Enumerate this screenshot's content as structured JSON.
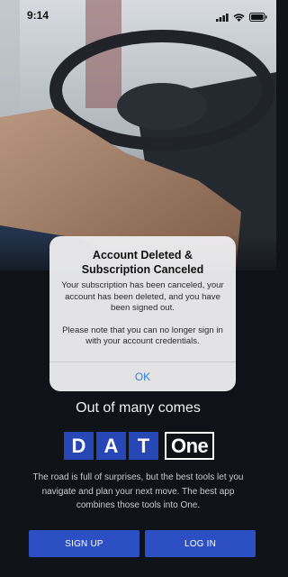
{
  "status_bar": {
    "time": "9:14",
    "icons": [
      "cellular-signal-icon",
      "wifi-icon",
      "battery-icon"
    ]
  },
  "alert": {
    "title": "Account Deleted & Subscription Canceled",
    "message_1": "Your subscription has been canceled, your account has been deleted, and you have been signed out.",
    "message_2": "Please note that you can no longer sign in with your account credentials.",
    "ok_label": "OK"
  },
  "hero": {
    "tagline": "Out of many comes",
    "logo_letters": [
      "D",
      "A",
      "T"
    ],
    "logo_word": "One",
    "description": "The road is full of surprises, but the best tools let you navigate and plan your next move. The best app combines those tools into One."
  },
  "actions": {
    "signup_label": "SIGN UP",
    "login_label": "LOG IN"
  },
  "colors": {
    "brand_blue": "#2d4fc4",
    "alert_action": "#2f7fe0",
    "background": "#101318"
  }
}
